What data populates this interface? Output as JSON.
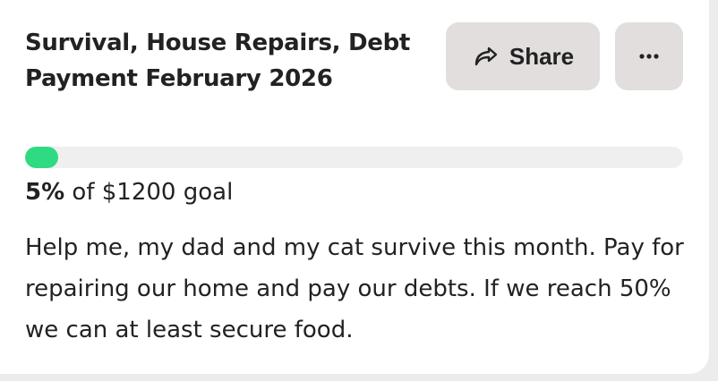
{
  "campaign": {
    "title": "Survival, House Repairs, Debt Payment February 2026",
    "description": "Help me, my dad and my cat survive this month. Pay for repairing our home and pay our debts. If we reach 50% we can at least secure food."
  },
  "actions": {
    "share_label": "Share",
    "share_icon": "share-arrow-icon",
    "more_icon": "more-horizontal-icon"
  },
  "progress": {
    "percent": 5,
    "percent_label": "5%",
    "goal_text": "of $1200 goal"
  },
  "colors": {
    "progress_fill": "#2edb83",
    "progress_track": "#efefef",
    "button_bg": "#e2dedd",
    "text": "#222222"
  }
}
